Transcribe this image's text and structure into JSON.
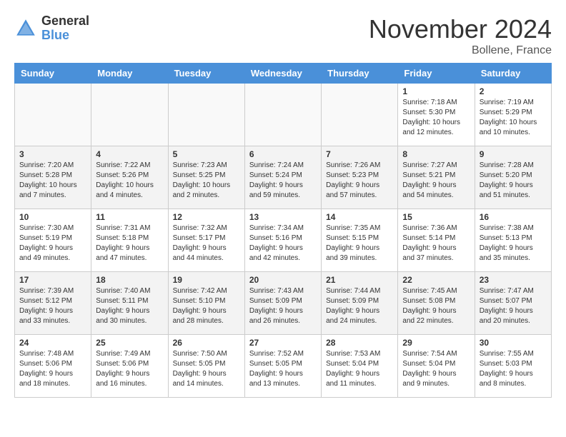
{
  "logo": {
    "general": "General",
    "blue": "Blue"
  },
  "header": {
    "month": "November 2024",
    "location": "Bollene, France"
  },
  "weekdays": [
    "Sunday",
    "Monday",
    "Tuesday",
    "Wednesday",
    "Thursday",
    "Friday",
    "Saturday"
  ],
  "weeks": [
    [
      {
        "day": "",
        "info": ""
      },
      {
        "day": "",
        "info": ""
      },
      {
        "day": "",
        "info": ""
      },
      {
        "day": "",
        "info": ""
      },
      {
        "day": "",
        "info": ""
      },
      {
        "day": "1",
        "info": "Sunrise: 7:18 AM\nSunset: 5:30 PM\nDaylight: 10 hours and 12 minutes."
      },
      {
        "day": "2",
        "info": "Sunrise: 7:19 AM\nSunset: 5:29 PM\nDaylight: 10 hours and 10 minutes."
      }
    ],
    [
      {
        "day": "3",
        "info": "Sunrise: 7:20 AM\nSunset: 5:28 PM\nDaylight: 10 hours and 7 minutes."
      },
      {
        "day": "4",
        "info": "Sunrise: 7:22 AM\nSunset: 5:26 PM\nDaylight: 10 hours and 4 minutes."
      },
      {
        "day": "5",
        "info": "Sunrise: 7:23 AM\nSunset: 5:25 PM\nDaylight: 10 hours and 2 minutes."
      },
      {
        "day": "6",
        "info": "Sunrise: 7:24 AM\nSunset: 5:24 PM\nDaylight: 9 hours and 59 minutes."
      },
      {
        "day": "7",
        "info": "Sunrise: 7:26 AM\nSunset: 5:23 PM\nDaylight: 9 hours and 57 minutes."
      },
      {
        "day": "8",
        "info": "Sunrise: 7:27 AM\nSunset: 5:21 PM\nDaylight: 9 hours and 54 minutes."
      },
      {
        "day": "9",
        "info": "Sunrise: 7:28 AM\nSunset: 5:20 PM\nDaylight: 9 hours and 51 minutes."
      }
    ],
    [
      {
        "day": "10",
        "info": "Sunrise: 7:30 AM\nSunset: 5:19 PM\nDaylight: 9 hours and 49 minutes."
      },
      {
        "day": "11",
        "info": "Sunrise: 7:31 AM\nSunset: 5:18 PM\nDaylight: 9 hours and 47 minutes."
      },
      {
        "day": "12",
        "info": "Sunrise: 7:32 AM\nSunset: 5:17 PM\nDaylight: 9 hours and 44 minutes."
      },
      {
        "day": "13",
        "info": "Sunrise: 7:34 AM\nSunset: 5:16 PM\nDaylight: 9 hours and 42 minutes."
      },
      {
        "day": "14",
        "info": "Sunrise: 7:35 AM\nSunset: 5:15 PM\nDaylight: 9 hours and 39 minutes."
      },
      {
        "day": "15",
        "info": "Sunrise: 7:36 AM\nSunset: 5:14 PM\nDaylight: 9 hours and 37 minutes."
      },
      {
        "day": "16",
        "info": "Sunrise: 7:38 AM\nSunset: 5:13 PM\nDaylight: 9 hours and 35 minutes."
      }
    ],
    [
      {
        "day": "17",
        "info": "Sunrise: 7:39 AM\nSunset: 5:12 PM\nDaylight: 9 hours and 33 minutes."
      },
      {
        "day": "18",
        "info": "Sunrise: 7:40 AM\nSunset: 5:11 PM\nDaylight: 9 hours and 30 minutes."
      },
      {
        "day": "19",
        "info": "Sunrise: 7:42 AM\nSunset: 5:10 PM\nDaylight: 9 hours and 28 minutes."
      },
      {
        "day": "20",
        "info": "Sunrise: 7:43 AM\nSunset: 5:09 PM\nDaylight: 9 hours and 26 minutes."
      },
      {
        "day": "21",
        "info": "Sunrise: 7:44 AM\nSunset: 5:09 PM\nDaylight: 9 hours and 24 minutes."
      },
      {
        "day": "22",
        "info": "Sunrise: 7:45 AM\nSunset: 5:08 PM\nDaylight: 9 hours and 22 minutes."
      },
      {
        "day": "23",
        "info": "Sunrise: 7:47 AM\nSunset: 5:07 PM\nDaylight: 9 hours and 20 minutes."
      }
    ],
    [
      {
        "day": "24",
        "info": "Sunrise: 7:48 AM\nSunset: 5:06 PM\nDaylight: 9 hours and 18 minutes."
      },
      {
        "day": "25",
        "info": "Sunrise: 7:49 AM\nSunset: 5:06 PM\nDaylight: 9 hours and 16 minutes."
      },
      {
        "day": "26",
        "info": "Sunrise: 7:50 AM\nSunset: 5:05 PM\nDaylight: 9 hours and 14 minutes."
      },
      {
        "day": "27",
        "info": "Sunrise: 7:52 AM\nSunset: 5:05 PM\nDaylight: 9 hours and 13 minutes."
      },
      {
        "day": "28",
        "info": "Sunrise: 7:53 AM\nSunset: 5:04 PM\nDaylight: 9 hours and 11 minutes."
      },
      {
        "day": "29",
        "info": "Sunrise: 7:54 AM\nSunset: 5:04 PM\nDaylight: 9 hours and 9 minutes."
      },
      {
        "day": "30",
        "info": "Sunrise: 7:55 AM\nSunset: 5:03 PM\nDaylight: 9 hours and 8 minutes."
      }
    ]
  ]
}
